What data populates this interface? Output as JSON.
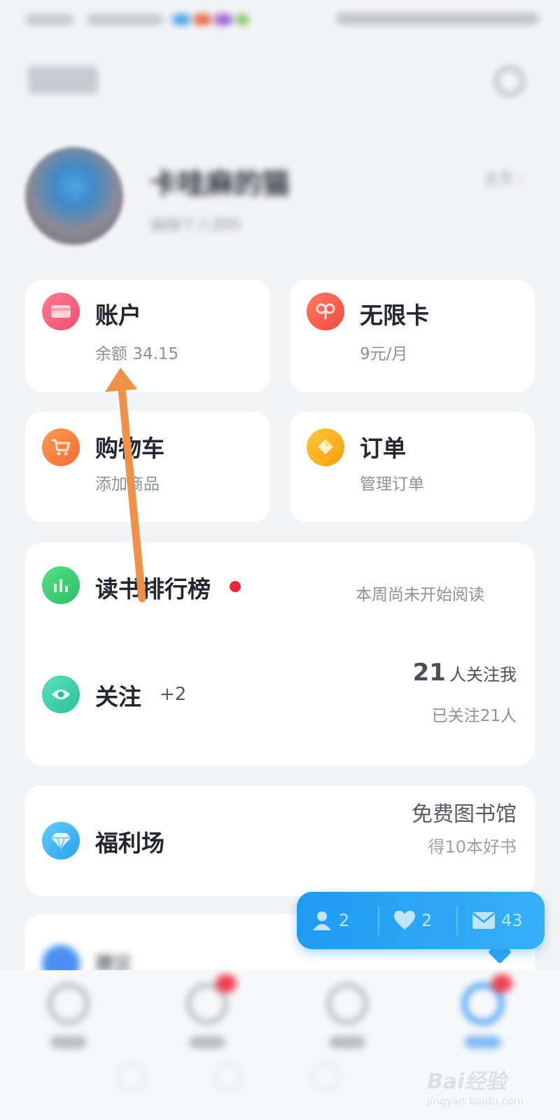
{
  "colors": {
    "background": "#f3f4f6",
    "card": "#ffffff",
    "accent_blue": "#2aa6f5",
    "red_dot": "#e8283a",
    "annotation_arrow": "#f0914a"
  },
  "status_bar": {
    "blurred": true
  },
  "top_nav": {
    "logo_icon": "app-logo-icon",
    "settings_icon": "settings-icon"
  },
  "profile": {
    "name": "卡哇麻的猫",
    "edit_label": "编辑个人资料",
    "more_label": "主页 ›",
    "blurred": true
  },
  "grid": {
    "account": {
      "title": "账户",
      "subtitle": "余额 34.15",
      "icon": "wallet-icon",
      "icon_color": "#f2607b"
    },
    "unlimited": {
      "title": "无限卡",
      "subtitle": "9元/月",
      "icon": "infinity-icon",
      "icon_color": "#f65c4b"
    },
    "cart": {
      "title": "购物车",
      "subtitle": "添加商品",
      "icon": "cart-icon",
      "icon_color": "#fb7e43"
    },
    "orders": {
      "title": "订单",
      "subtitle": "管理订单",
      "icon": "order-icon",
      "icon_color": "#fbb01f"
    }
  },
  "reading_rank": {
    "title": "读书排行榜",
    "status": "本周尚未开始阅读",
    "icon": "bar-chart-icon",
    "icon_color": "#3ccf6f",
    "has_new": true
  },
  "follow": {
    "title": "关注",
    "delta": "+2",
    "followers_count": "21",
    "followers_label": "人关注我",
    "following_label": "已关注21人",
    "icon": "eye-icon",
    "icon_color": "#3dcea9"
  },
  "welfare": {
    "title": "福利场",
    "primary": "免费图书馆",
    "secondary": "得10本好书",
    "icon": "diamond-icon",
    "icon_color": "#3cb2f2"
  },
  "partial_row": {
    "title": "建议",
    "icon": "partial-icon",
    "blurred": true
  },
  "float_bar": {
    "friends_count": "2",
    "likes_count": "2",
    "messages_count": "43",
    "friends_icon": "person-icon",
    "likes_icon": "heart-icon",
    "messages_icon": "mail-icon"
  },
  "tab_bar": {
    "tabs": [
      {
        "label": "书架",
        "icon": "bookshelf-icon",
        "badge": false,
        "active": false
      },
      {
        "label": "书城",
        "icon": "bookstore-icon",
        "badge": true,
        "active": false
      },
      {
        "label": "读一读",
        "icon": "discover-icon",
        "badge": false,
        "active": false
      },
      {
        "label": "我",
        "icon": "me-icon",
        "badge": true,
        "active": true
      }
    ]
  },
  "watermark": {
    "main": "Bai经验",
    "sub": "jingyan.baidu.com"
  }
}
